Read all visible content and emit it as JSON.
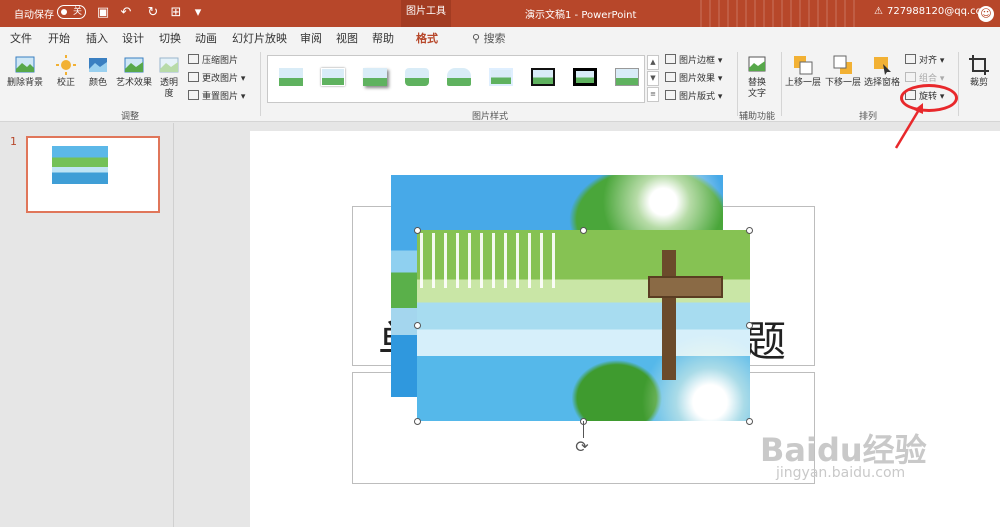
{
  "titlebar": {
    "autosave_label": "自动保存",
    "autosave_state": "关",
    "context_tab": "图片工具",
    "doc_title": "演示文稿1 - PowerPoint",
    "account": "727988120@qq.com"
  },
  "tabs": [
    "文件",
    "开始",
    "插入",
    "设计",
    "切换",
    "动画",
    "幻灯片放映",
    "审阅",
    "视图",
    "帮助",
    "格式"
  ],
  "active_tab": "格式",
  "search_label": "搜索",
  "ribbon": {
    "adjust": {
      "remove_bg": "删除背景",
      "correct": "校正",
      "color": "颜色",
      "art_effects": "艺术效果",
      "transparency_1": "透明",
      "transparency_2": "度",
      "compress": "压缩图片",
      "change": "更改图片",
      "reset": "重置图片",
      "group_label": "调整"
    },
    "styles": {
      "border": "图片边框",
      "effects": "图片效果",
      "layout": "图片版式",
      "group_label": "图片样式"
    },
    "accessibility": {
      "alt_text_1": "替换",
      "alt_text_2": "文字",
      "group_label": "辅助功能"
    },
    "arrange": {
      "bring_forward": "上移一层",
      "send_backward": "下移一层",
      "selection_pane": "选择窗格",
      "align": "对齐",
      "group": "组合",
      "rotate": "旋转",
      "group_label": "排列"
    },
    "crop": "裁剪"
  },
  "slide_pane": {
    "slide_number": "1"
  },
  "slide": {
    "title_left_char": "单",
    "title_right_char": "题"
  },
  "watermark": {
    "brand": "Baidu经验",
    "url": "jingyan.baidu.com"
  },
  "colors": {
    "accent": "#b7472a",
    "annotation": "#e8282b"
  }
}
